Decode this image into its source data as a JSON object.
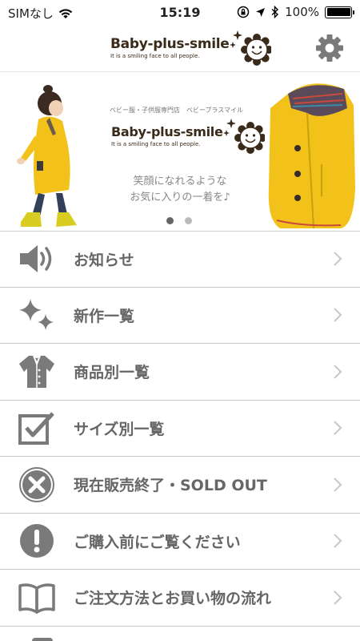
{
  "status_bar": {
    "carrier": "SIMなし",
    "time": "15:19",
    "battery": "100%",
    "battery_level": 1.0
  },
  "header": {
    "logo_name": "Baby-plus-smile",
    "logo_tagline": "It is a smiling face to all people."
  },
  "banner": {
    "subtitle": "ベビー服・子供服専門店　ベビープラスマイル",
    "logo_name": "Baby-plus-smile",
    "logo_tagline": "It is a smiling face to all people.",
    "copy_line1": "笑顔になれるような",
    "copy_line2": "お気に入りの一着を♪",
    "slide_count": 2,
    "active_slide": 1
  },
  "menu": {
    "items": [
      {
        "label": "お知らせ",
        "icon": "speaker-icon"
      },
      {
        "label": "新作一覧",
        "icon": "sparkle-icon"
      },
      {
        "label": "商品別一覧",
        "icon": "shirt-icon"
      },
      {
        "label": "サイズ別一覧",
        "icon": "checkbox-icon"
      },
      {
        "label": "現在販売終了・SOLD OUT",
        "icon": "close-circle-icon"
      },
      {
        "label": "ご購入前にご覧ください",
        "icon": "exclamation-icon"
      },
      {
        "label": "ご注文方法とお買い物の流れ",
        "icon": "book-icon"
      }
    ]
  },
  "colors": {
    "icon_gray": "#7a7a7a",
    "label_gray": "#666666",
    "chevron_gray": "#c7c7cc",
    "coat_yellow": "#f2c21b",
    "logo_brown": "#3a2a1a"
  }
}
